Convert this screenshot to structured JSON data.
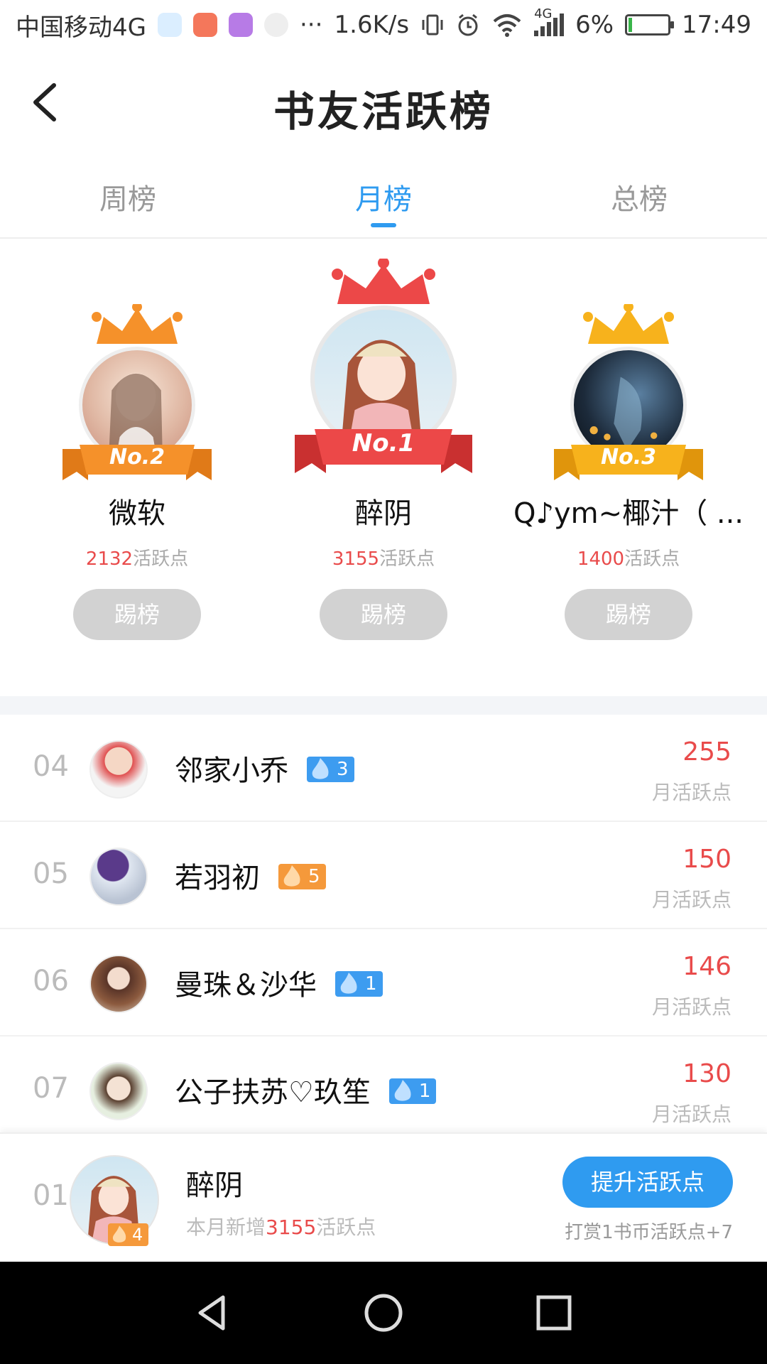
{
  "status_bar": {
    "carrier": "中国移动4G",
    "more": "···",
    "net_speed": "1.6K/s",
    "network": "4G",
    "battery": "6%",
    "time": "17:49"
  },
  "header": {
    "title": "书友活跃榜"
  },
  "tabs": [
    {
      "label": "周榜",
      "active": false
    },
    {
      "label": "月榜",
      "active": true
    },
    {
      "label": "总榜",
      "active": false
    }
  ],
  "podium": [
    {
      "rank_label": "No.2",
      "name": "微软",
      "points": "2132",
      "points_unit": "活跃点",
      "button": "踢榜",
      "ribbon_color": "#f5912a",
      "crown_color": "#f5912a"
    },
    {
      "rank_label": "No.1",
      "name": "醉阴",
      "points": "3155",
      "points_unit": "活跃点",
      "button": "踢榜",
      "ribbon_color": "#ec4848",
      "crown_color": "#ec4848"
    },
    {
      "rank_label": "No.3",
      "name": "Q♪ym~椰汁（ ...",
      "points": "1400",
      "points_unit": "活跃点",
      "button": "踢榜",
      "ribbon_color": "#f7b21c",
      "crown_color": "#f7b21c"
    }
  ],
  "list": [
    {
      "rank": "04",
      "name": "邻家小乔",
      "level": "3",
      "badge_color": "blue",
      "score": "255",
      "unit": "月活跃点"
    },
    {
      "rank": "05",
      "name": "若羽初",
      "level": "5",
      "badge_color": "orange",
      "score": "150",
      "unit": "月活跃点"
    },
    {
      "rank": "06",
      "name": "曼珠＆沙华",
      "level": "1",
      "badge_color": "blue",
      "score": "146",
      "unit": "月活跃点"
    },
    {
      "rank": "07",
      "name": "公子扶苏♡玖笙",
      "level": "1",
      "badge_color": "blue",
      "score": "130",
      "unit": "月活跃点"
    }
  ],
  "my_rank": {
    "rank": "01",
    "name": "醉阴",
    "level": "4",
    "sub_prefix": "本月新增",
    "sub_points": "3155",
    "sub_suffix": "活跃点",
    "boost_button": "提升活跃点",
    "reward_text": "打赏1书币活跃点+7"
  },
  "colors": {
    "accent": "#2f9bf0",
    "points_red": "#e94b4b"
  }
}
